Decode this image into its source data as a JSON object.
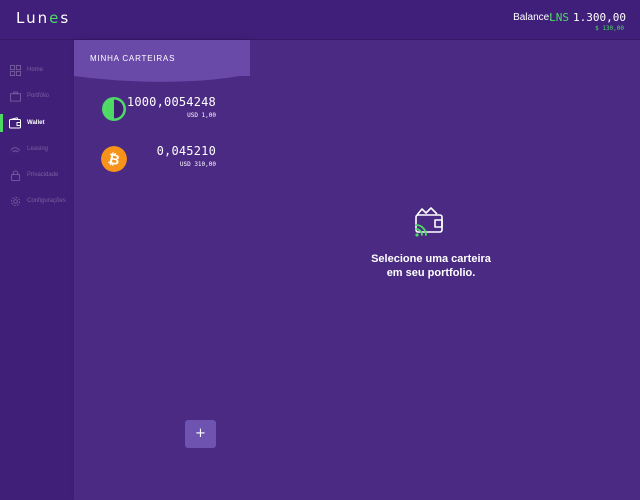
{
  "app": {
    "logo_text": "Lun",
    "logo_accent": "e",
    "logo_tail": "s"
  },
  "header": {
    "balance_label": "Balance:",
    "balance_currency": "LNS",
    "balance_amount": "1.300,00",
    "balance_usd": "$ 130,00"
  },
  "sidebar": {
    "items": [
      {
        "label": "Home",
        "icon": "grid-icon"
      },
      {
        "label": "Portfólio",
        "icon": "briefcase-icon"
      },
      {
        "label": "Wallet",
        "icon": "wallet-icon",
        "active": true
      },
      {
        "label": "Leasing",
        "icon": "leasing-icon"
      },
      {
        "label": "Privacidade",
        "icon": "privacy-icon"
      },
      {
        "label": "Configurações",
        "icon": "gear-icon"
      }
    ]
  },
  "wallets": {
    "title": "MINHA CARTEIRAS",
    "items": [
      {
        "coin": "lunes",
        "icon": "lunes-coin-icon",
        "amount": "1000,0054248",
        "usd": "USD 1,00"
      },
      {
        "coin": "bitcoin",
        "icon": "bitcoin-icon",
        "amount": "0,045210",
        "usd": "USD 310,00"
      }
    ],
    "add_label": "+"
  },
  "main": {
    "empty_line1": "Selecione uma carteira",
    "empty_line2": "em seu portfolio."
  },
  "colors": {
    "accent_green": "#4cd964",
    "bitcoin_orange": "#f7931a",
    "background": "#4a2a82"
  }
}
